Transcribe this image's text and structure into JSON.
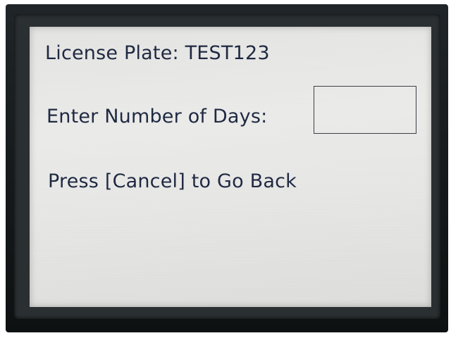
{
  "screen": {
    "license_plate_line": "License Plate: TEST123",
    "days_prompt": "Enter Number of Days:",
    "days_input": {
      "value": "",
      "placeholder": ""
    },
    "cancel_hint": "Press [Cancel] to Go Back"
  },
  "colors": {
    "text": "#1d2740",
    "screen_background": "#e6e6e4",
    "bezel": "#15191b",
    "input_border": "#3a3f46"
  }
}
